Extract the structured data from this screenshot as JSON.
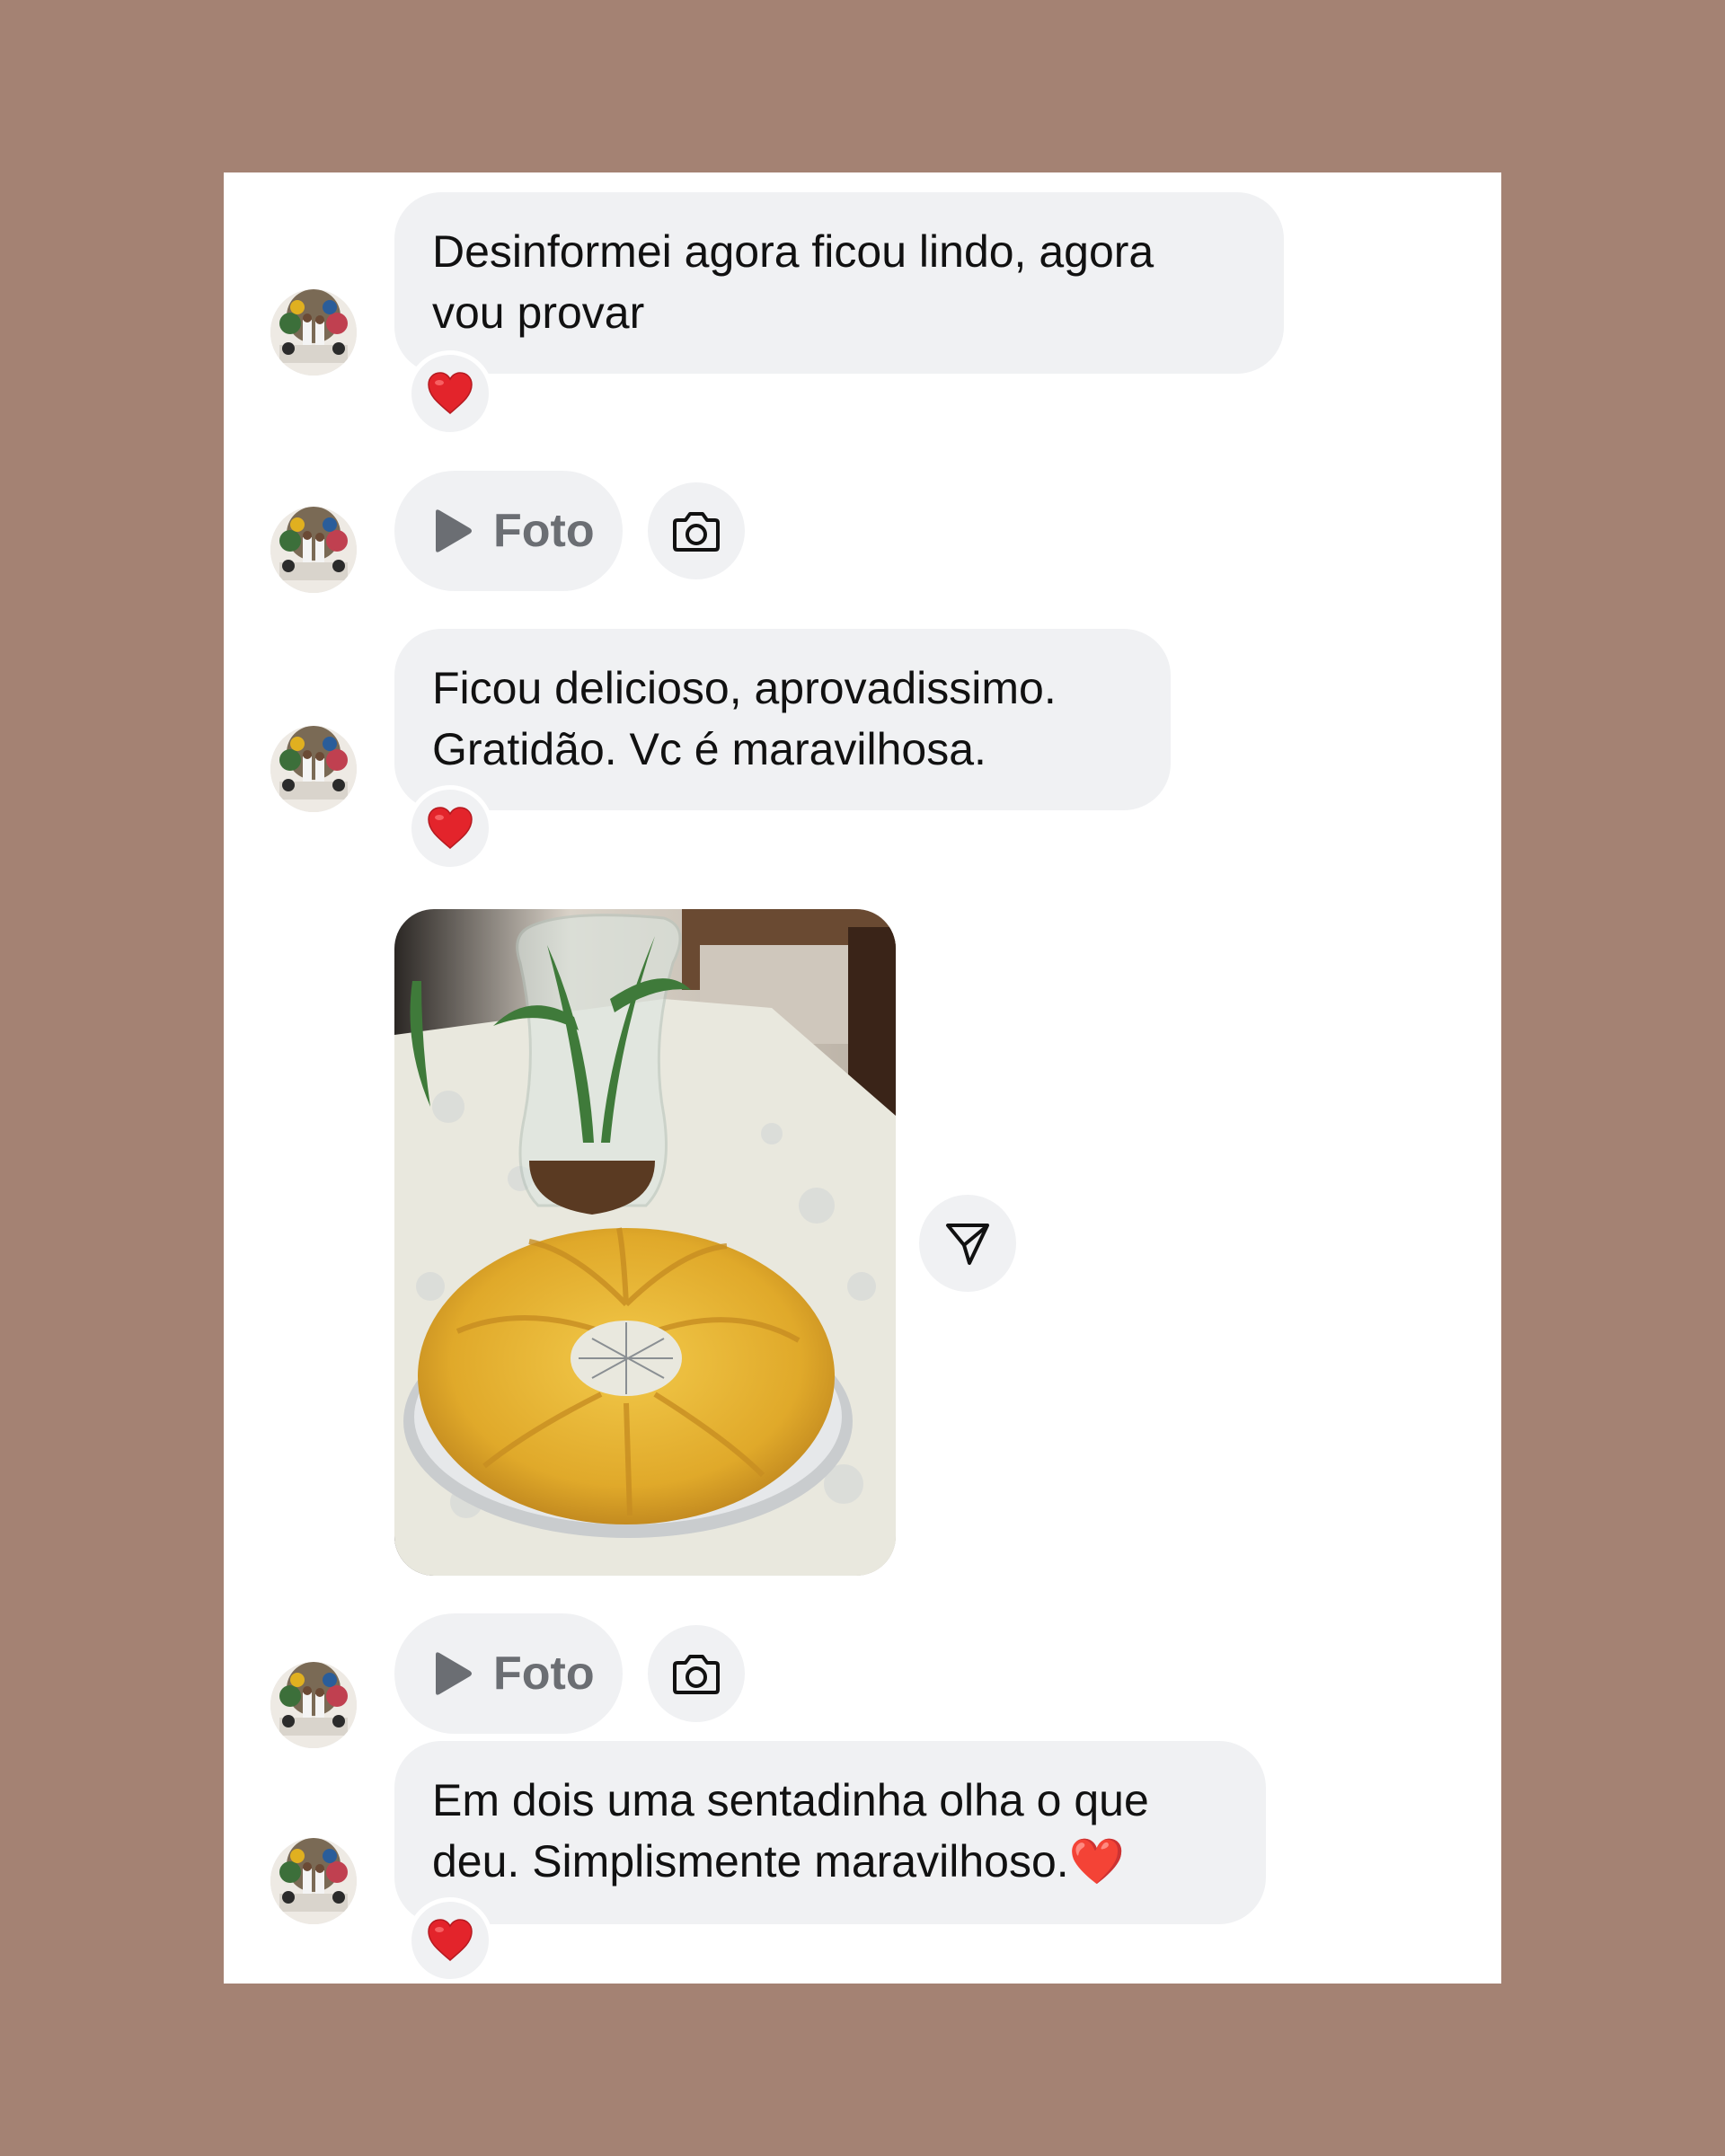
{
  "messages": [
    {
      "text": "Desinformei agora ficou lindo, agora\nvou provar",
      "reaction": "❤️"
    },
    {
      "pill_label": "Foto"
    },
    {
      "text": "Ficou delicioso, aprovadissimo.\nGratidão. Vc é maravilhosa.",
      "reaction": "❤️"
    },
    {
      "image_alt": "photo of a ring-shaped cake on a platter beside a glass vase with plants"
    },
    {
      "pill_label": "Foto"
    },
    {
      "text": "Em dois uma sentadinha olha o que\ndeu. Simplismente maravilhoso.❤️",
      "reaction": "❤️"
    }
  ],
  "icons": {
    "play": "play-icon",
    "camera": "camera-icon",
    "share": "send-icon",
    "heart": "heart-icon"
  },
  "colors": {
    "backdrop": "#a48273",
    "panel": "#ffffff",
    "bubble": "#f0f1f3",
    "heart": "#e3242b"
  }
}
